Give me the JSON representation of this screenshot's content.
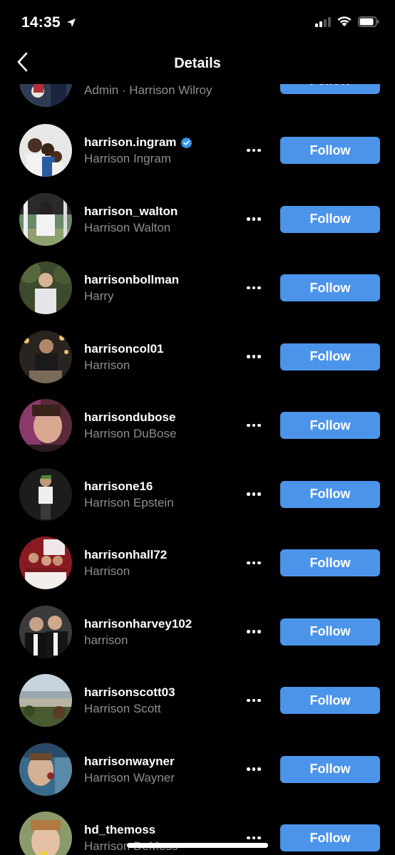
{
  "status_bar": {
    "time": "14:35"
  },
  "nav": {
    "title": "Details"
  },
  "partial_row": {
    "subtitle": "Admin · Harrison Wilroy",
    "follow_label": "Follow"
  },
  "rows": [
    {
      "username": "harrison.ingram",
      "fullname": "Harrison Ingram",
      "verified": true,
      "follow_label": "Follow"
    },
    {
      "username": "harrison_walton",
      "fullname": "Harrison Walton",
      "follow_label": "Follow"
    },
    {
      "username": "harrisonbollman",
      "fullname": "Harry",
      "follow_label": "Follow"
    },
    {
      "username": "harrisoncol01",
      "fullname": "Harrison",
      "follow_label": "Follow"
    },
    {
      "username": "harrisondubose",
      "fullname": "Harrison DuBose",
      "follow_label": "Follow"
    },
    {
      "username": "harrisone16",
      "fullname": "Harrison Epstein",
      "follow_label": "Follow"
    },
    {
      "username": "harrisonhall72",
      "fullname": "Harrison",
      "follow_label": "Follow"
    },
    {
      "username": "harrisonharvey102",
      "fullname": "harrison",
      "follow_label": "Follow"
    },
    {
      "username": "harrisonscott03",
      "fullname": "Harrison Scott",
      "follow_label": "Follow"
    },
    {
      "username": "harrisonwayner",
      "fullname": "Harrison Wayner",
      "follow_label": "Follow"
    },
    {
      "username": "hd_themoss",
      "fullname": "Harrison DeMoss",
      "follow_label": "Follow"
    }
  ],
  "colors": {
    "accent": "#4c94ea",
    "secondary_text": "#8e8e8e",
    "background": "#000000",
    "verified": "#3897f0"
  },
  "icons": {
    "back": "chevron-left-icon",
    "more": "more-horizontal-icon",
    "verified": "verified-badge-icon",
    "location": "location-arrow-icon"
  }
}
